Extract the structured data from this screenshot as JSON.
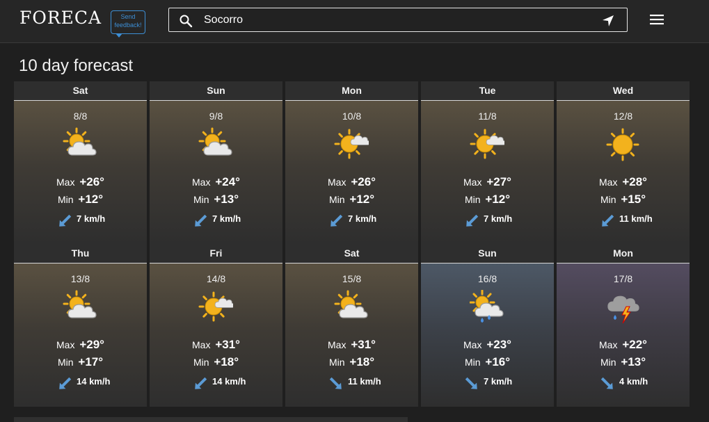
{
  "header": {
    "logo": "FORECA",
    "feedback": [
      "Send",
      "feedback!"
    ],
    "search_value": "Socorro",
    "icons": [
      "search-icon",
      "location-arrow-icon",
      "hamburger-menu-icon"
    ]
  },
  "page_title": "10 day forecast",
  "days": [
    {
      "name": "Sat",
      "date": "8/8",
      "icon": "partly-cloudy",
      "max_label": "Max",
      "max": "+26°",
      "min_label": "Min",
      "min": "+12°",
      "wind": "7 km/h",
      "wind_dir": "from-northeast"
    },
    {
      "name": "Sun",
      "date": "9/8",
      "icon": "partly-cloudy",
      "max_label": "Max",
      "max": "+24°",
      "min_label": "Min",
      "min": "+13°",
      "wind": "7 km/h",
      "wind_dir": "from-northeast"
    },
    {
      "name": "Mon",
      "date": "10/8",
      "icon": "mostly-sunny",
      "max_label": "Max",
      "max": "+26°",
      "min_label": "Min",
      "min": "+12°",
      "wind": "7 km/h",
      "wind_dir": "from-northeast"
    },
    {
      "name": "Tue",
      "date": "11/8",
      "icon": "mostly-sunny",
      "max_label": "Max",
      "max": "+27°",
      "min_label": "Min",
      "min": "+12°",
      "wind": "7 km/h",
      "wind_dir": "from-northeast"
    },
    {
      "name": "Wed",
      "date": "12/8",
      "icon": "sunny",
      "max_label": "Max",
      "max": "+28°",
      "min_label": "Min",
      "min": "+15°",
      "wind": "11 km/h",
      "wind_dir": "from-northeast"
    },
    {
      "name": "Thu",
      "date": "13/8",
      "icon": "partly-cloudy",
      "max_label": "Max",
      "max": "+29°",
      "min_label": "Min",
      "min": "+17°",
      "wind": "14 km/h",
      "wind_dir": "from-northeast"
    },
    {
      "name": "Fri",
      "date": "14/8",
      "icon": "mostly-sunny",
      "max_label": "Max",
      "max": "+31°",
      "min_label": "Min",
      "min": "+18°",
      "wind": "14 km/h",
      "wind_dir": "from-northeast"
    },
    {
      "name": "Sat",
      "date": "15/8",
      "icon": "partly-cloudy",
      "max_label": "Max",
      "max": "+31°",
      "min_label": "Min",
      "min": "+18°",
      "wind": "11 km/h",
      "wind_dir": "from-southeast"
    },
    {
      "name": "Sun",
      "date": "16/8",
      "icon": "showers",
      "max_label": "Max",
      "max": "+23°",
      "min_label": "Min",
      "min": "+16°",
      "wind": "7 km/h",
      "wind_dir": "from-southeast"
    },
    {
      "name": "Mon",
      "date": "17/8",
      "icon": "thunderstorm",
      "max_label": "Max",
      "max": "+22°",
      "min_label": "Min",
      "min": "+13°",
      "wind": "4 km/h",
      "wind_dir": "from-southeast"
    }
  ],
  "colors": {
    "sun": "#f3b21d",
    "cloud": "#e9e9e9",
    "wind_arrow": "#5b9bd5",
    "feedback": "#3d8fd6",
    "lightning": "#f3b21d",
    "rain": "#4a90e2"
  }
}
